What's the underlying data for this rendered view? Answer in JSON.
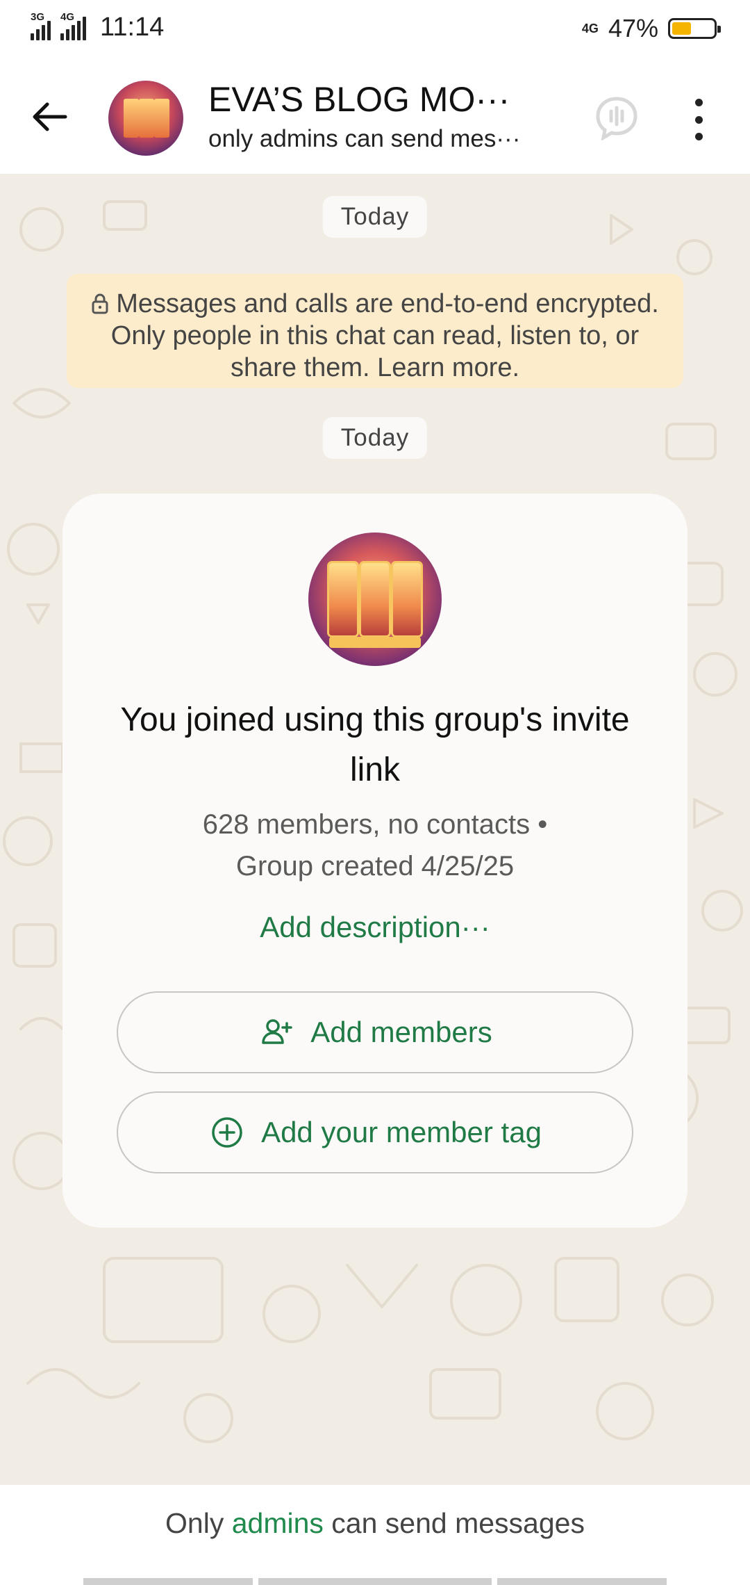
{
  "status_bar": {
    "network_1": "3G",
    "network_2": "4G",
    "time": "11:14",
    "network_right": "4G",
    "battery_percent": "47%",
    "battery_level": 0.47,
    "battery_color": "#f5b400"
  },
  "header": {
    "back_icon": "arrow-left-icon",
    "title": "EVA’S BLOG MO···",
    "subtitle": "only admins can send mes···",
    "voice_icon": "voice-chat-icon",
    "menu_icon": "more-vertical-icon"
  },
  "chat": {
    "date_chip_1": "Today",
    "encryption_notice": "Messages and calls are end-to-end encrypted. Only people in this chat can read, listen to, or share them. Learn more.",
    "date_chip_2": "Today",
    "card": {
      "title": "You joined using this group's invite link",
      "meta_line_1": "628 members, no contacts •",
      "meta_line_2": "Group created 4/25/25",
      "description_link": "Add description···",
      "add_members_label": "Add members",
      "add_member_tag_label": "Add your member tag"
    }
  },
  "bottom_bar": {
    "prefix": "Only ",
    "link": "admins",
    "suffix": " can send messages"
  },
  "colors": {
    "accent_green": "#1f7a45",
    "chat_background": "#f2ede4",
    "encryption_bg": "#fceccb"
  }
}
